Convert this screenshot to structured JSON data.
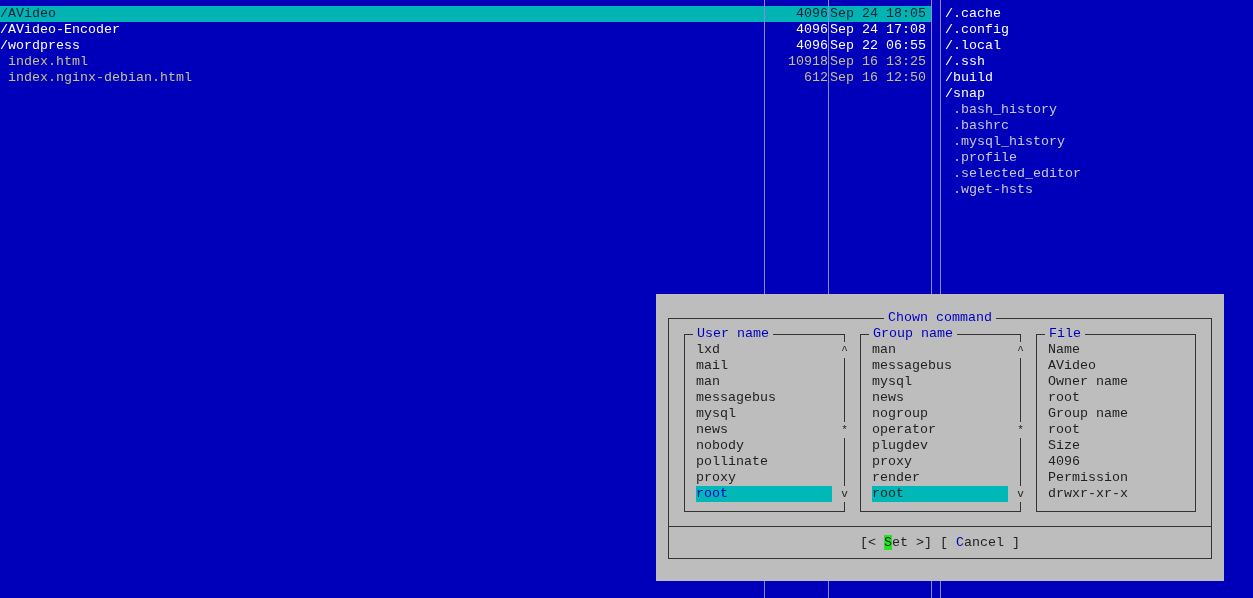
{
  "left_panel": {
    "rows": [
      {
        "name": "/AVideo",
        "size": "4096",
        "date": "Sep 24 18:05",
        "kind": "dir",
        "selected": true
      },
      {
        "name": "/AVideo-Encoder",
        "size": "4096",
        "date": "Sep 24 17:08",
        "kind": "dir",
        "selected": false
      },
      {
        "name": "/wordpress",
        "size": "4096",
        "date": "Sep 22 06:55",
        "kind": "dir",
        "selected": false
      },
      {
        "name": "index.html",
        "size": "10918",
        "date": "Sep 16 13:25",
        "kind": "file",
        "selected": false
      },
      {
        "name": "index.nginx-debian.html",
        "size": "612",
        "date": "Sep 16 12:50",
        "kind": "file",
        "selected": false
      }
    ]
  },
  "right_panel": {
    "rows": [
      {
        "name": "/.cache",
        "kind": "dir"
      },
      {
        "name": "/.config",
        "kind": "dir"
      },
      {
        "name": "/.local",
        "kind": "dir"
      },
      {
        "name": "/.ssh",
        "kind": "dir"
      },
      {
        "name": "/build",
        "kind": "dir"
      },
      {
        "name": "/snap",
        "kind": "dir"
      },
      {
        "name": ".bash_history",
        "kind": "file"
      },
      {
        "name": ".bashrc",
        "kind": "file"
      },
      {
        "name": ".mysql_history",
        "kind": "file"
      },
      {
        "name": ".profile",
        "kind": "file"
      },
      {
        "name": ".selected_editor",
        "kind": "file"
      },
      {
        "name": ".wget-hsts",
        "kind": "file"
      }
    ]
  },
  "dialog": {
    "title": "Chown command",
    "lists": [
      {
        "title": "User name",
        "focused": true,
        "scroll": {
          "up": "^",
          "thumb": "*",
          "down": "v"
        },
        "items": [
          {
            "label": "lxd",
            "selected": false
          },
          {
            "label": "mail",
            "selected": false
          },
          {
            "label": "man",
            "selected": false
          },
          {
            "label": "messagebus",
            "selected": false
          },
          {
            "label": "mysql",
            "selected": false
          },
          {
            "label": "news",
            "selected": false
          },
          {
            "label": "nobody",
            "selected": false
          },
          {
            "label": "pollinate",
            "selected": false
          },
          {
            "label": "proxy",
            "selected": false
          },
          {
            "label": "root",
            "selected": true
          }
        ]
      },
      {
        "title": "Group name",
        "focused": false,
        "scroll": {
          "up": "^",
          "thumb": "*",
          "down": "v"
        },
        "items": [
          {
            "label": "man",
            "selected": false
          },
          {
            "label": "messagebus",
            "selected": false
          },
          {
            "label": "mysql",
            "selected": false
          },
          {
            "label": "news",
            "selected": false
          },
          {
            "label": "nogroup",
            "selected": false
          },
          {
            "label": "operator",
            "selected": false
          },
          {
            "label": "plugdev",
            "selected": false
          },
          {
            "label": "proxy",
            "selected": false
          },
          {
            "label": "render",
            "selected": false
          },
          {
            "label": "root",
            "selected": true
          }
        ]
      }
    ],
    "file_info": {
      "title": "File",
      "lines": [
        "Name",
        "AVideo",
        "Owner name",
        "root",
        "Group name",
        "root",
        "Size",
        "4096",
        "Permission",
        "drwxr-xr-x"
      ]
    },
    "buttons": [
      {
        "before": "[< ",
        "hotkey": "S",
        "after": "et >]",
        "selected": true
      },
      {
        "before": "[ ",
        "hotkey": "C",
        "after": "ancel ]",
        "selected": false
      }
    ]
  }
}
